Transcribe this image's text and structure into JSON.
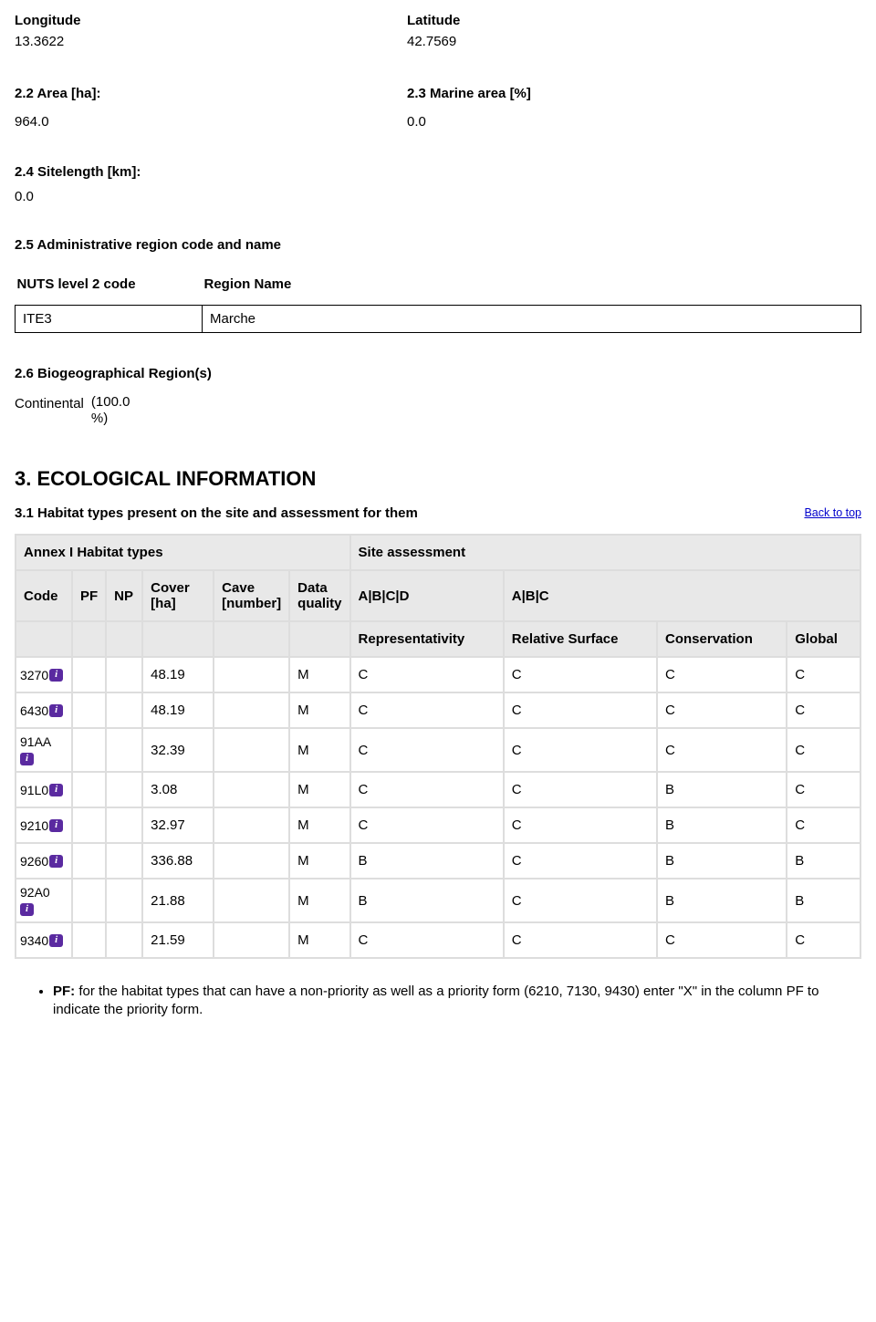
{
  "coords": {
    "lonLabel": "Longitude",
    "lonValue": "13.3622",
    "latLabel": "Latitude",
    "latValue": "42.7569"
  },
  "area": {
    "areaLabel": "2.2 Area [ha]:",
    "areaValue": "964.0",
    "marineLabel": "2.3 Marine area [%]",
    "marineValue": "0.0"
  },
  "sitelength": {
    "label": "2.4 Sitelength [km]:",
    "value": "0.0"
  },
  "admin": {
    "heading": "2.5 Administrative region code and name",
    "colCode": "NUTS level 2 code",
    "colName": "Region Name",
    "rows": [
      {
        "code": "ITE3",
        "name": "Marche"
      }
    ]
  },
  "biogeo": {
    "heading": "2.6 Biogeographical Region(s)",
    "name": "Continental",
    "pct1": "(100.0",
    "pct2": "%)"
  },
  "section3": {
    "title": "3. ECOLOGICAL INFORMATION",
    "sub31": "3.1 Habitat types present on the site and assessment for them",
    "backTop": "Back to top"
  },
  "habHeaders": {
    "annex": "Annex I Habitat types",
    "siteAssess": "Site assessment",
    "code": "Code",
    "pf": "PF",
    "np": "NP",
    "cover": "Cover [ha]",
    "cave": "Cave [number]",
    "dq": "Data quality",
    "abcd": "A|B|C|D",
    "abc": "A|B|C",
    "rep": "Representativity",
    "relsurf": "Relative Surface",
    "cons": "Conservation",
    "global": "Global"
  },
  "habRows": [
    {
      "code": "3270",
      "cover": "48.19",
      "dq": "M",
      "rep": "C",
      "rs": "C",
      "cons": "C",
      "glob": "C"
    },
    {
      "code": "6430",
      "cover": "48.19",
      "dq": "M",
      "rep": "C",
      "rs": "C",
      "cons": "C",
      "glob": "C"
    },
    {
      "code": "91AA",
      "cover": "32.39",
      "dq": "M",
      "rep": "C",
      "rs": "C",
      "cons": "C",
      "glob": "C",
      "iconBelow": true
    },
    {
      "code": "91L0",
      "cover": "3.08",
      "dq": "M",
      "rep": "C",
      "rs": "C",
      "cons": "B",
      "glob": "C"
    },
    {
      "code": "9210",
      "cover": "32.97",
      "dq": "M",
      "rep": "C",
      "rs": "C",
      "cons": "B",
      "glob": "C"
    },
    {
      "code": "9260",
      "cover": "336.88",
      "dq": "M",
      "rep": "B",
      "rs": "C",
      "cons": "B",
      "glob": "B"
    },
    {
      "code": "92A0",
      "cover": "21.88",
      "dq": "M",
      "rep": "B",
      "rs": "C",
      "cons": "B",
      "glob": "B",
      "iconBelow": true
    },
    {
      "code": "9340",
      "cover": "21.59",
      "dq": "M",
      "rep": "C",
      "rs": "C",
      "cons": "C",
      "glob": "C"
    }
  ],
  "notes": {
    "pfLabel": "PF:",
    "pfText": " for the habitat types that can have a non-priority as well as a priority form (6210, 7130, 9430) enter \"X\" in the column PF to indicate the priority form."
  }
}
